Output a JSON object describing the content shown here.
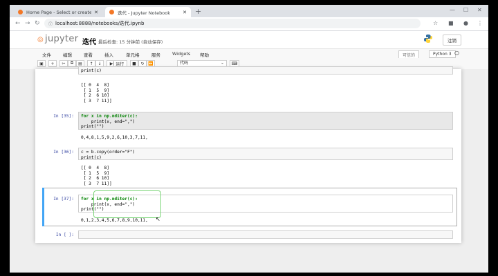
{
  "browser": {
    "tabs": [
      {
        "title": "Home Page - Select or create a",
        "active": false,
        "favicon_color": "#f37726"
      },
      {
        "title": "迭代 - Jupyter Notebook",
        "active": true,
        "favicon_color": "#f37726"
      }
    ],
    "new_tab": "+",
    "url": "localhost:8888/notebooks/迭代.ipynb"
  },
  "jupyter": {
    "logo_text": "jupyter",
    "notebook_name": "迭代",
    "checkpoint": "最后检查: 15 分钟前 (自动保存)",
    "logout_label": "注销",
    "menu": [
      "文件",
      "编辑",
      "查看",
      "插入",
      "单元格",
      "服务",
      "Widgets",
      "帮助"
    ],
    "trusted_label": "可信的",
    "kernel_label": "Python 3",
    "toolbar": {
      "run_label": "运行",
      "cell_type": "代码"
    }
  },
  "cells": [
    {
      "prompt": "",
      "code": "print(c)",
      "output": "[[ 0  4  8]\n [ 1  5  9]\n [ 2  6 10]\n [ 3  7 11]]"
    },
    {
      "prompt": "In [35]:",
      "code_lines": [
        "for x in np.nditer(c):",
        "    print(x, end=\",\")",
        "print(\"\")"
      ],
      "output": "0,4,8,1,5,9,2,6,10,3,7,11,"
    },
    {
      "prompt": "In [36]:",
      "code_lines": [
        "c = b.copy(order=\"F\")",
        "print(c)"
      ],
      "output": "[[ 0  4  8]\n [ 1  5  9]\n [ 2  6 10]\n [ 3  7 11]]"
    },
    {
      "prompt": "In [37]:",
      "code_lines": [
        "for x in np.nditer(c):",
        "    print(x, end=\",\")",
        "print(\"\")"
      ],
      "output": "0,1,2,3,4,5,6,7,8,9,10,11,"
    },
    {
      "prompt": "In [ ]:",
      "code": ""
    }
  ]
}
